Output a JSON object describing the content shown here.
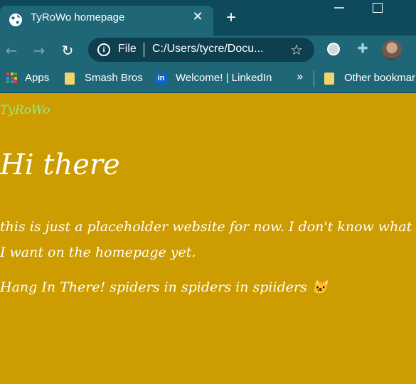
{
  "browser": {
    "tab": {
      "title": "TyRoWo homepage",
      "close_icon": "close-icon",
      "favicon": "globe-icon"
    },
    "new_tab_label": "+",
    "address_bar": {
      "scheme_label": "File",
      "url": "C:/Users/tycre/Docu..."
    },
    "bookmarks": [
      {
        "label": "Apps",
        "icon": "apps-grid-icon"
      },
      {
        "label": "Smash Bros",
        "icon": "folder-icon"
      },
      {
        "label": "Welcome! | LinkedIn",
        "icon": "linkedin-icon"
      },
      {
        "label": "Other bookmarks",
        "icon": "folder-icon"
      }
    ],
    "overflow_label": "»"
  },
  "page": {
    "brand": "TyRoWo",
    "heading": "Hi there",
    "paragraph": "this is just a placeholder website for now. I don't know what I want on the homepage yet.",
    "paragraph2": "Hang In There! spiders in spiders in spiiders 🐱"
  },
  "colors": {
    "page_background": "#cc9c00",
    "title_bar": "#0e4a5b",
    "toolbar": "#1f6676",
    "brand_text": "#8ef08a"
  }
}
